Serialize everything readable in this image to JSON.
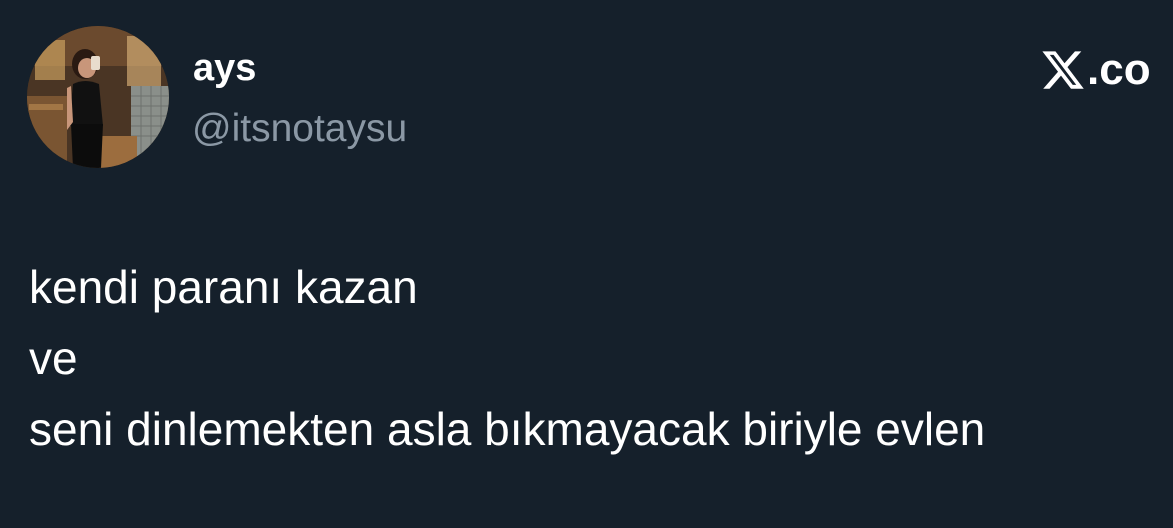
{
  "author": {
    "display_name": "ays",
    "handle": "@itsnotaysu",
    "avatar_icon": "profile-photo"
  },
  "brand": {
    "logo_icon": "x-logo-icon",
    "logo_text": ".co"
  },
  "tweet": {
    "lines": [
      "kendi paranı kazan",
      "ve",
      "seni dinlemekten asla bıkmayacak biriyle evlen"
    ]
  },
  "colors": {
    "background": "#15202b",
    "primary_text": "#ffffff",
    "secondary_text": "#8b98a5"
  }
}
